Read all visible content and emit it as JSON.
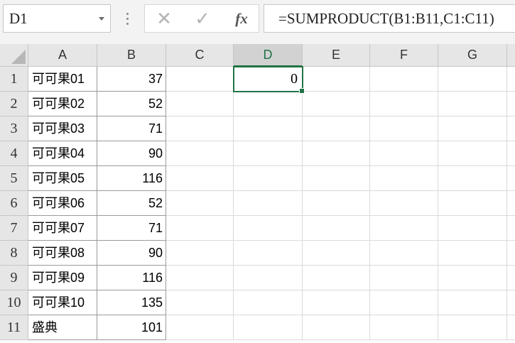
{
  "formula_bar": {
    "name_box": "D1",
    "cancel_icon": "✕",
    "enter_icon": "✓",
    "fx_label": "fx",
    "formula": "=SUMPRODUCT(B1:B11,C1:C11)"
  },
  "columns": [
    "A",
    "B",
    "C",
    "D",
    "E",
    "F",
    "G"
  ],
  "selected_column": "D",
  "selected_cell": "D1",
  "selected_cell_value": "0",
  "rows": [
    {
      "num": "1",
      "a": "可可果01",
      "b": "37"
    },
    {
      "num": "2",
      "a": "可可果02",
      "b": "52"
    },
    {
      "num": "3",
      "a": "可可果03",
      "b": "71"
    },
    {
      "num": "4",
      "a": "可可果04",
      "b": "90"
    },
    {
      "num": "5",
      "a": "可可果05",
      "b": "116"
    },
    {
      "num": "6",
      "a": "可可果06",
      "b": "52"
    },
    {
      "num": "7",
      "a": "可可果07",
      "b": "71"
    },
    {
      "num": "8",
      "a": "可可果08",
      "b": "90"
    },
    {
      "num": "9",
      "a": "可可果09",
      "b": "116"
    },
    {
      "num": "10",
      "a": "可可果10",
      "b": "135"
    },
    {
      "num": "11",
      "a": "盛典",
      "b": "101"
    }
  ],
  "colors": {
    "accent": "#217346",
    "header_bg": "#e6e6e6"
  }
}
